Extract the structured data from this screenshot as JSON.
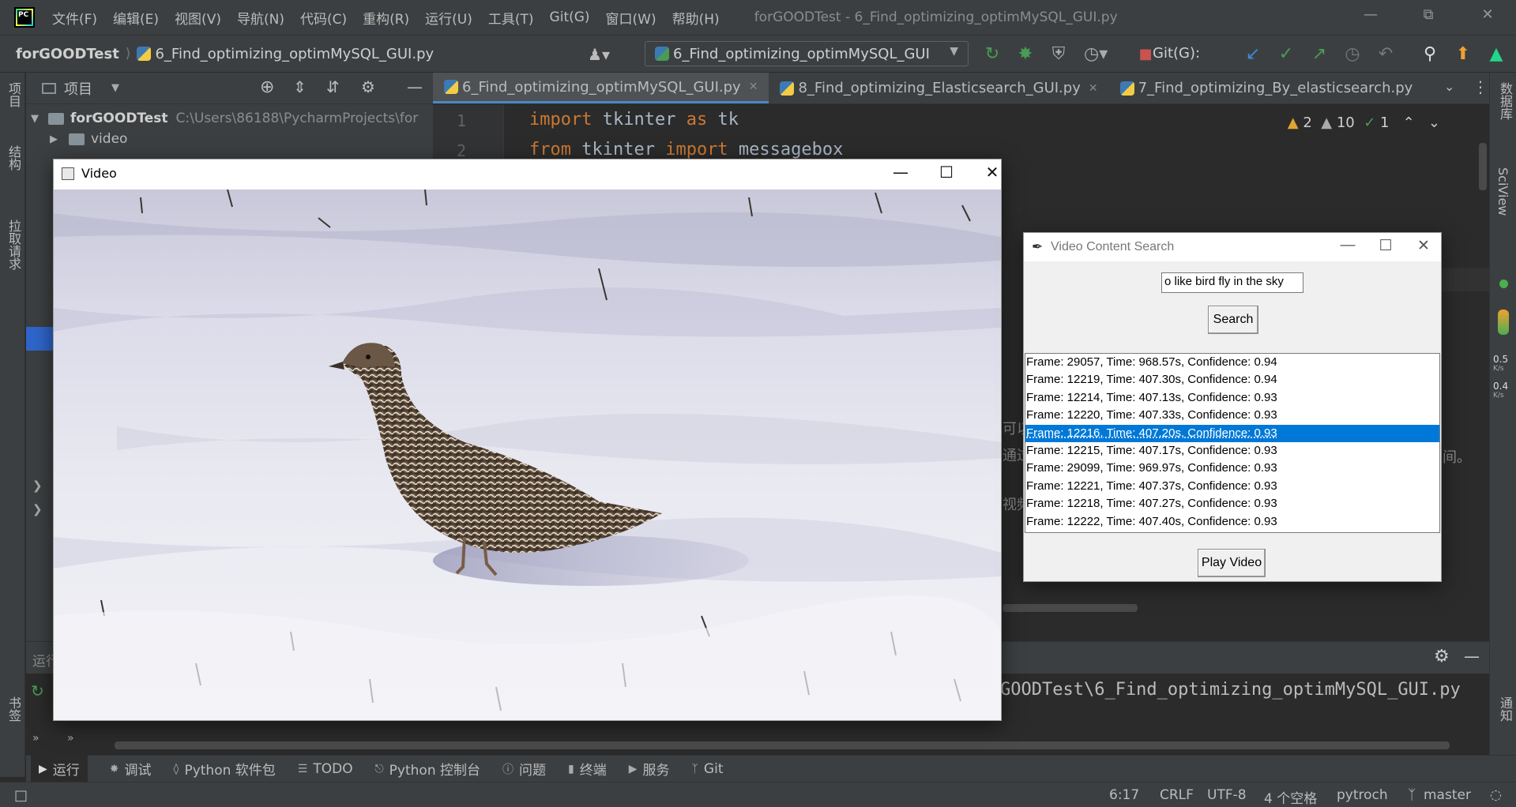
{
  "menubar": {
    "logo_text": "PC",
    "items": [
      "文件(F)",
      "编辑(E)",
      "视图(V)",
      "导航(N)",
      "代码(C)",
      "重构(R)",
      "运行(U)",
      "工具(T)",
      "Git(G)",
      "窗口(W)",
      "帮助(H)"
    ],
    "window_title": "forGOODTest - 6_Find_optimizing_optimMySQL_GUI.py"
  },
  "navbar": {
    "project": "forGOODTest",
    "file": "6_Find_optimizing_optimMySQL_GUI.py",
    "run_config": "6_Find_optimizing_optimMySQL_GUI",
    "git_label": "Git(G):"
  },
  "left_strip": {
    "labels": [
      "项目",
      "结构",
      "拉取请求",
      "书签"
    ]
  },
  "right_strip": {
    "labels": [
      "数据库",
      "SciView",
      "通知"
    ],
    "net_up": "0.5",
    "net_down": "0.4",
    "net_unit": "K/s"
  },
  "project_panel": {
    "title": "项目",
    "root_name": "forGOODTest",
    "root_path": "C:\\Users\\86188\\PycharmProjects\\for",
    "child_folder": "video"
  },
  "editor": {
    "tabs": [
      {
        "label": "6_Find_optimizing_optimMySQL_GUI.py",
        "active": true
      },
      {
        "label": "8_Find_optimizing_Elasticsearch_GUI.py",
        "active": false
      },
      {
        "label": "7_Find_optimizing_By_elasticsearch.py",
        "active": false
      }
    ],
    "lines": [
      {
        "no": "1",
        "kw1": "import",
        "t1": " tkinter ",
        "kw2": "as",
        "t2": " tk"
      },
      {
        "no": "2",
        "kw1": "from",
        "t1": " tkinter ",
        "kw2": "import",
        "t2": " messagebox"
      }
    ],
    "warnings_a": "2",
    "warnings_b": "10",
    "checks": "1",
    "side_fragments": [
      "可以",
      "通过",
      "视频"
    ],
    "side_fragment_right": "间。"
  },
  "run_panel": {
    "label": "运行",
    "output": "GOODTest\\6_Find_optimizing_optimMySQL_GUI.py"
  },
  "bottom_tabs": [
    {
      "icon": "run-icon",
      "label": "运行",
      "active": true
    },
    {
      "icon": "debug-icon",
      "label": "调试",
      "active": false
    },
    {
      "icon": "packages-icon",
      "label": "Python 软件包",
      "active": false
    },
    {
      "icon": "todo-icon",
      "label": "TODO",
      "active": false
    },
    {
      "icon": "python-console-icon",
      "label": "Python 控制台",
      "active": false
    },
    {
      "icon": "problems-icon",
      "label": "问题",
      "active": false
    },
    {
      "icon": "terminal-icon",
      "label": "终端",
      "active": false
    },
    {
      "icon": "services-icon",
      "label": "服务",
      "active": false
    },
    {
      "icon": "git-icon",
      "label": "Git",
      "active": false
    }
  ],
  "statusbar": {
    "position": "6:17",
    "line_ending": "CRLF",
    "encoding": "UTF-8",
    "indent": "4 个空格",
    "interpreter": "pytroch",
    "branch": "master"
  },
  "video_window": {
    "title": "Video"
  },
  "search_window": {
    "title": "Video Content Search",
    "query_value": "o like bird fly in the sky",
    "search_label": "Search",
    "play_label": "Play Video",
    "results": [
      "Frame: 29057, Time: 968.57s, Confidence: 0.94",
      "Frame: 12219, Time: 407.30s, Confidence: 0.94",
      "Frame: 12214, Time: 407.13s, Confidence: 0.93",
      "Frame: 12220, Time: 407.33s, Confidence: 0.93",
      "Frame: 12216, Time: 407.20s, Confidence: 0.93",
      "Frame: 12215, Time: 407.17s, Confidence: 0.93",
      "Frame: 29099, Time: 969.97s, Confidence: 0.93",
      "Frame: 12221, Time: 407.37s, Confidence: 0.93",
      "Frame: 12218, Time: 407.27s, Confidence: 0.93",
      "Frame: 12222, Time: 407.40s, Confidence: 0.93"
    ],
    "selected_index": 4
  },
  "colors": {
    "ide_bg": "#2b2b2b",
    "panel_bg": "#3c3f41",
    "accent_blue": "#4a88c7",
    "selection": "#0078d7",
    "keyword": "#cc7832",
    "run_green": "#499c54",
    "stop_red": "#c75450"
  }
}
